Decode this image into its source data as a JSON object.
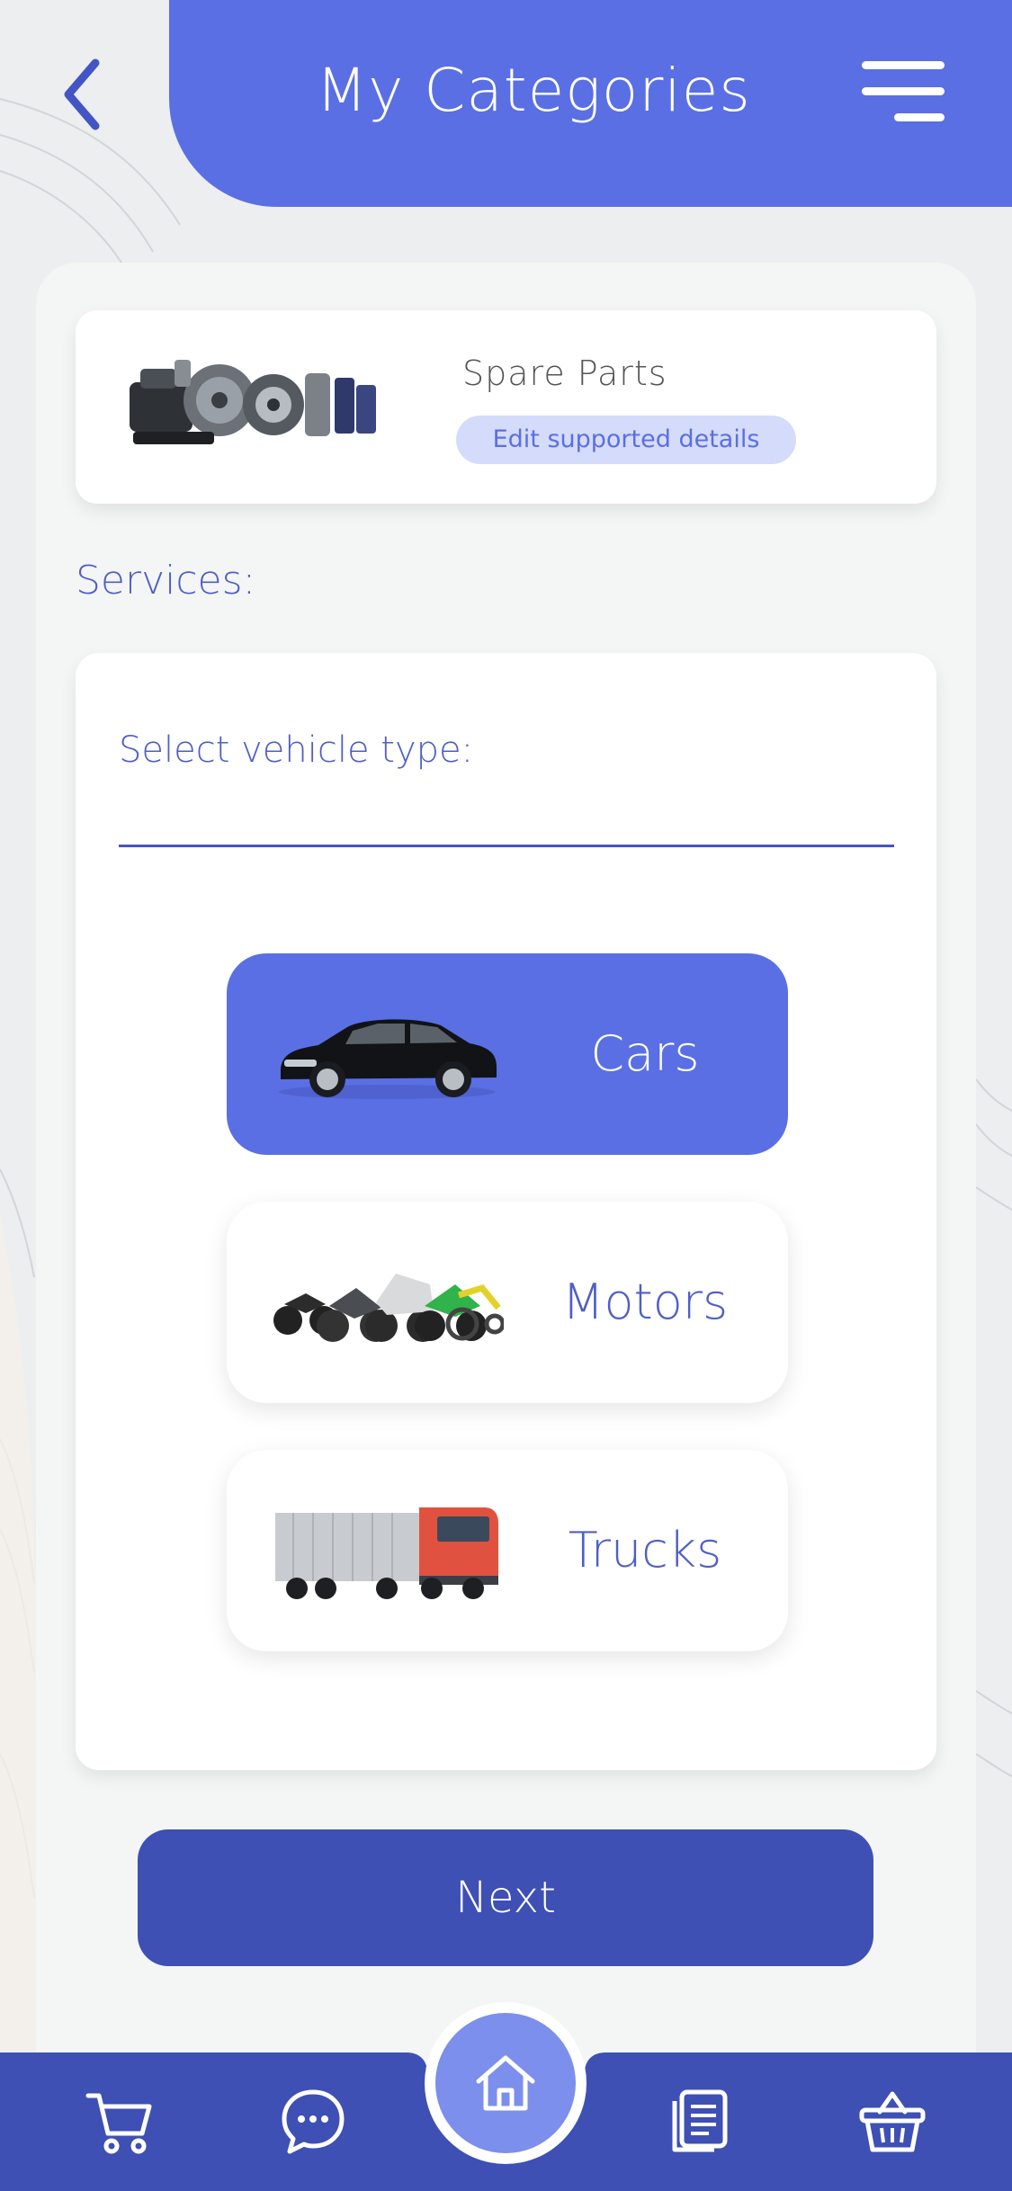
{
  "header": {
    "title": "My Categories"
  },
  "category": {
    "name": "Spare Parts",
    "edit_label": "Edit supported details"
  },
  "services": {
    "section_label": "Services:",
    "field_label": "Select vehicle type:",
    "options": [
      {
        "label": "Cars",
        "selected": true
      },
      {
        "label": "Motors",
        "selected": false
      },
      {
        "label": "Trucks",
        "selected": false
      }
    ]
  },
  "actions": {
    "next_label": "Next"
  },
  "colors": {
    "primary": "#5a6fe3",
    "primary_dark": "#3e50b4",
    "chip_bg": "#d5dbfa",
    "home_button": "#7c8fec"
  },
  "bottom_nav": {
    "items": [
      "cart-icon",
      "chat-icon",
      "home-icon",
      "document-icon",
      "basket-icon"
    ],
    "active": "home-icon"
  }
}
